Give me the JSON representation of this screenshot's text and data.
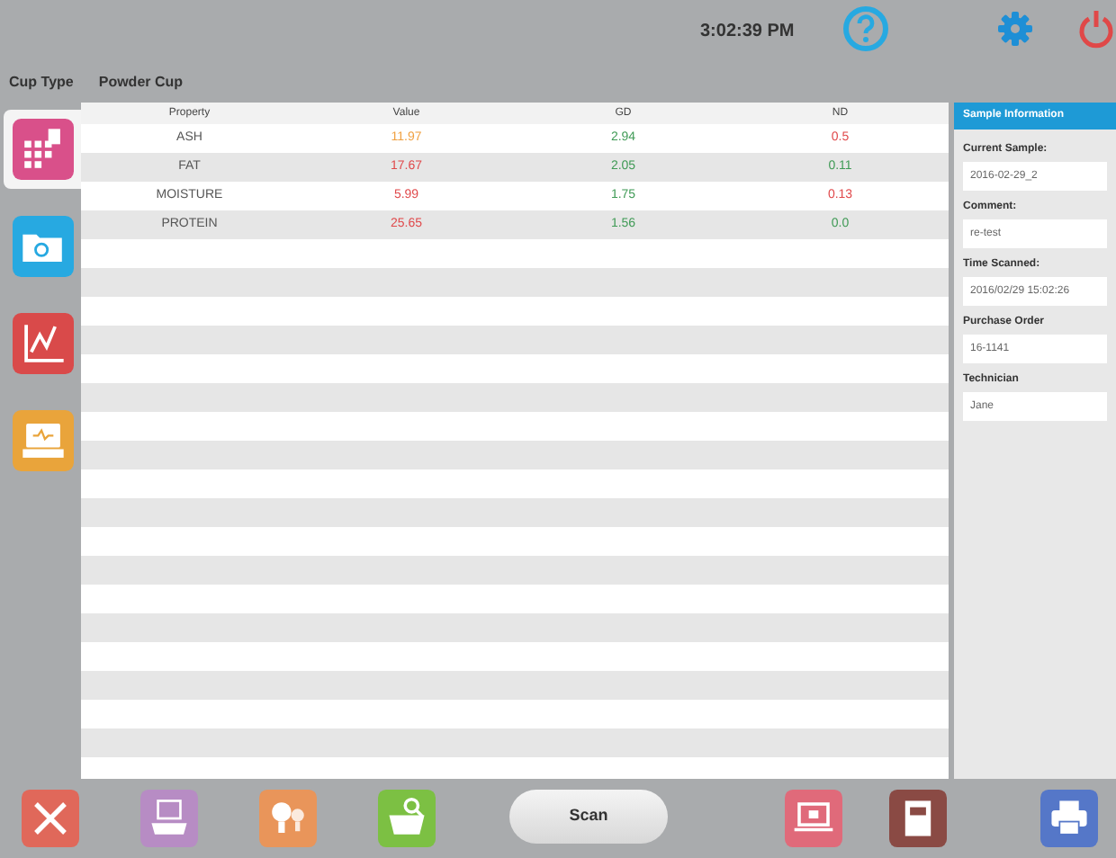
{
  "header": {
    "time": "3:02:39 PM",
    "cup_type_label": "Cup Type",
    "cup_type_value": "Powder Cup"
  },
  "sidebar": {
    "items": [
      {
        "kind": "grid",
        "color": "#d9508a",
        "selected": true
      },
      {
        "kind": "folder",
        "color": "#27a9e1",
        "selected": false
      },
      {
        "kind": "chart",
        "color": "#d94a4a",
        "selected": false
      },
      {
        "kind": "monitor",
        "color": "#e9a43b",
        "selected": false
      }
    ]
  },
  "table": {
    "columns": [
      "Property",
      "Value",
      "GD",
      "ND"
    ],
    "rows": [
      {
        "property": "ASH",
        "value": {
          "text": "11.97",
          "color": "#f0a040"
        },
        "gd": {
          "text": "2.94",
          "color": "#3f9a55"
        },
        "nd": {
          "text": "0.5",
          "color": "#e0484a"
        }
      },
      {
        "property": "FAT",
        "value": {
          "text": "17.67",
          "color": "#e0484a"
        },
        "gd": {
          "text": "2.05",
          "color": "#3f9a55"
        },
        "nd": {
          "text": "0.11",
          "color": "#3f9a55"
        }
      },
      {
        "property": "MOISTURE",
        "value": {
          "text": "5.99",
          "color": "#e0484a"
        },
        "gd": {
          "text": "1.75",
          "color": "#3f9a55"
        },
        "nd": {
          "text": "0.13",
          "color": "#e0484a"
        }
      },
      {
        "property": "PROTEIN",
        "value": {
          "text": "25.65",
          "color": "#e0484a"
        },
        "gd": {
          "text": "1.56",
          "color": "#3f9a55"
        },
        "nd": {
          "text": "0.0",
          "color": "#3f9a55"
        }
      }
    ]
  },
  "sample_information": {
    "title": "Sample Information",
    "fields": [
      {
        "label": "Current Sample:",
        "value": "2016-02-29_2"
      },
      {
        "label": "Comment:",
        "value": "re-test"
      },
      {
        "label": "Time Scanned:",
        "value": "2016/02/29 15:02:26"
      },
      {
        "label": "Purchase Order",
        "value": "16-1141"
      },
      {
        "label": "Technician",
        "value": "Jane"
      }
    ]
  },
  "toolbar": {
    "items": [
      {
        "kind": "tools",
        "color": "#e0685a"
      },
      {
        "kind": "scanner",
        "color": "#b78cc4"
      },
      {
        "kind": "bulbs",
        "color": "#e9955a"
      },
      {
        "kind": "basket",
        "color": "#7cc043"
      },
      {
        "kind": "scan",
        "label": "Scan"
      },
      {
        "kind": "laptop",
        "color": "#e06a7a"
      },
      {
        "kind": "book",
        "color": "#8a4a44"
      },
      {
        "kind": "printer",
        "color": "#5577c8"
      }
    ]
  }
}
